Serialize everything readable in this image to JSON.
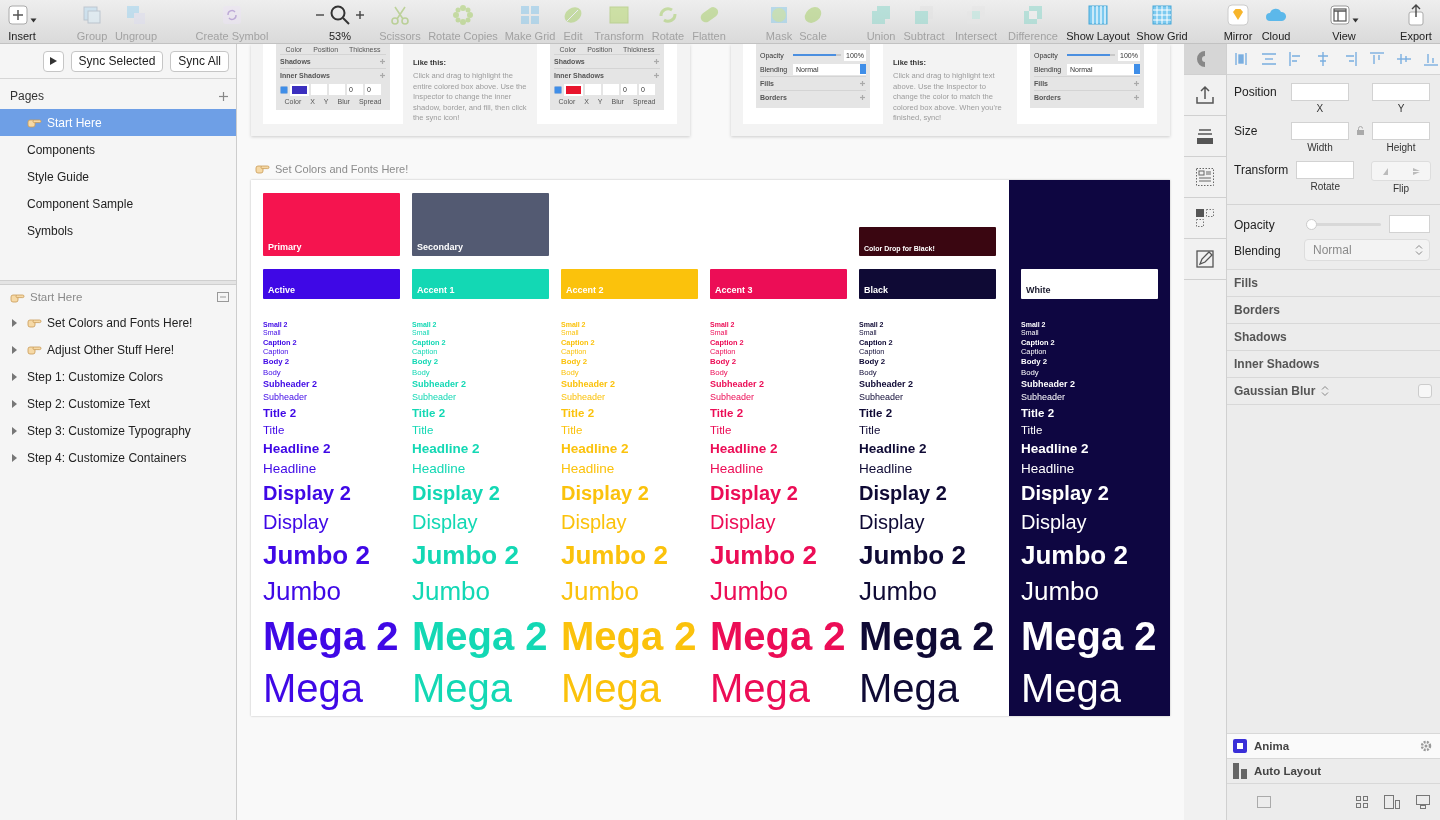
{
  "toolbar": {
    "items": [
      {
        "label": "Insert",
        "kind": "menu",
        "disabled": false
      },
      {
        "label": "Group",
        "kind": "button",
        "disabled": true
      },
      {
        "label": "Ungroup",
        "kind": "button",
        "disabled": true
      },
      {
        "label": "Create Symbol",
        "kind": "button",
        "disabled": true
      },
      {
        "label": "53%",
        "kind": "zoom",
        "disabled": false
      },
      {
        "label": "Scissors",
        "kind": "button",
        "disabled": true
      },
      {
        "label": "Rotate Copies",
        "kind": "button",
        "disabled": true
      },
      {
        "label": "Make Grid",
        "kind": "button",
        "disabled": true
      },
      {
        "label": "Edit",
        "kind": "button",
        "disabled": true
      },
      {
        "label": "Transform",
        "kind": "button",
        "disabled": true
      },
      {
        "label": "Rotate",
        "kind": "button",
        "disabled": true
      },
      {
        "label": "Flatten",
        "kind": "button",
        "disabled": true
      },
      {
        "label": "Mask",
        "kind": "button",
        "disabled": true
      },
      {
        "label": "Scale",
        "kind": "button",
        "disabled": true
      },
      {
        "label": "Union",
        "kind": "button",
        "disabled": true
      },
      {
        "label": "Subtract",
        "kind": "button",
        "disabled": true
      },
      {
        "label": "Intersect",
        "kind": "button",
        "disabled": true
      },
      {
        "label": "Difference",
        "kind": "button",
        "disabled": true
      },
      {
        "label": "Show Layout",
        "kind": "button",
        "disabled": false
      },
      {
        "label": "Show Grid",
        "kind": "button",
        "disabled": false
      },
      {
        "label": "Mirror",
        "kind": "button",
        "disabled": false
      },
      {
        "label": "Cloud",
        "kind": "button",
        "disabled": false
      },
      {
        "label": "View",
        "kind": "menu",
        "disabled": false
      },
      {
        "label": "Export",
        "kind": "button",
        "disabled": false
      }
    ]
  },
  "sync_bar": {
    "buttons": [
      "Sync Selected",
      "Sync All"
    ]
  },
  "pages": {
    "title": "Pages",
    "items": [
      {
        "label": "Start Here",
        "emoji": true,
        "selected": true
      },
      {
        "label": "Components",
        "emoji": false,
        "selected": false
      },
      {
        "label": "Style Guide",
        "emoji": false,
        "selected": false
      },
      {
        "label": "Component Sample",
        "emoji": false,
        "selected": false
      },
      {
        "label": "Symbols",
        "emoji": false,
        "selected": false
      }
    ]
  },
  "layers": {
    "artboard": {
      "label": "Start Here",
      "emoji": true
    },
    "items": [
      {
        "label": "Set Colors and Fonts Here!",
        "emoji": true,
        "expanded": false
      },
      {
        "label": "Adjust Other Stuff Here!",
        "emoji": true,
        "expanded": false
      },
      {
        "label": "Step 1: Customize Colors",
        "emoji": false,
        "expanded": false
      },
      {
        "label": "Step 2: Customize Text",
        "emoji": false,
        "expanded": false
      },
      {
        "label": "Step 3: Customize Typography",
        "emoji": false,
        "expanded": false
      },
      {
        "label": "Step 4: Customize Containers",
        "emoji": false,
        "expanded": false
      }
    ]
  },
  "tutorial_cards": [
    {
      "panels": [
        {
          "kind": "shadow",
          "captions": [
            "Color",
            "Position",
            "Thickness"
          ],
          "sections": [
            "Shadows",
            "Inner Shadows"
          ],
          "checked": true,
          "color": "#3b2fbf",
          "values": [
            "0",
            "0"
          ],
          "field_captions": [
            "Color",
            "X",
            "Y",
            "Blur",
            "Spread"
          ]
        },
        {
          "kind": "shadow",
          "captions": [
            "Color",
            "Position",
            "Thickness"
          ],
          "sections": [
            "Shadows",
            "Inner Shadows"
          ],
          "checked": true,
          "color": "#e8142c",
          "values": [
            "0",
            "0"
          ],
          "field_captions": [
            "Color",
            "X",
            "Y",
            "Blur",
            "Spread"
          ]
        }
      ],
      "note": {
        "heading": "Like this:",
        "text": "Click and drag to highlight the entire colored box above. Use the Inspector to change the inner shadow, border, and fill, then click the sync icon!"
      }
    },
    {
      "panels": [
        {
          "kind": "layer",
          "opacity_label": "Opacity",
          "level": 0.9,
          "opacity_value": "100%",
          "blending_label": "Blending",
          "blending_value": "Normal",
          "sections": [
            "Fills",
            "Borders"
          ]
        },
        {
          "kind": "layer",
          "opacity_label": "Opacity",
          "level": 0.9,
          "opacity_value": "100%",
          "blending_label": "Blending",
          "blending_value": "Normal",
          "sections": [
            "Fills",
            "Borders"
          ]
        }
      ],
      "note": {
        "heading": "Like this:",
        "text": "Click and drag to highlight text above. Use the Inspector to change the color to match the colored box above. When you're finished, sync!"
      }
    }
  ],
  "section_label": {
    "text": "Set Colors and Fonts Here!",
    "emoji": true
  },
  "palette": {
    "columns": [
      {
        "dark": false,
        "top_swatch": {
          "label": "Primary",
          "color": "#f5144f",
          "kind": "tall"
        },
        "swatch": {
          "label": "Active",
          "color": "#3f08e6"
        },
        "styles": [
          {
            "label": "Small 2",
            "kind": "small",
            "bold": true
          },
          {
            "label": "Small",
            "kind": "small",
            "bold": false
          },
          {
            "label": "Caption 2",
            "kind": "caption",
            "bold": true
          },
          {
            "label": "Caption",
            "kind": "caption",
            "bold": false
          },
          {
            "label": "Body 2",
            "kind": "body",
            "bold": true
          },
          {
            "label": "Body",
            "kind": "body",
            "bold": false
          },
          {
            "label": "Subheader 2",
            "kind": "subheader",
            "bold": true
          },
          {
            "label": "Subheader",
            "kind": "subheader",
            "bold": false
          },
          {
            "label": "Title 2",
            "kind": "title",
            "bold": true
          },
          {
            "label": "Title",
            "kind": "title",
            "bold": false
          },
          {
            "label": "Headline 2",
            "kind": "headline",
            "bold": true
          },
          {
            "label": "Headline",
            "kind": "headline",
            "bold": false
          },
          {
            "label": "Display 2",
            "kind": "display",
            "bold": true
          },
          {
            "label": "Display",
            "kind": "display",
            "bold": false
          },
          {
            "label": "Jumbo 2",
            "kind": "jumbo",
            "bold": true
          },
          {
            "label": "Jumbo",
            "kind": "jumbo",
            "bold": false
          },
          {
            "label": "Mega 2",
            "kind": "mega",
            "bold": true
          },
          {
            "label": "Mega",
            "kind": "mega",
            "bold": false
          }
        ]
      },
      {
        "dark": false,
        "top_swatch": {
          "label": "Secondary",
          "color": "#535a72",
          "kind": "tall"
        },
        "swatch": {
          "label": "Accent 1",
          "color": "#13d8b4"
        },
        "styles": [
          {
            "label": "Small 2",
            "kind": "small",
            "bold": true
          },
          {
            "label": "Small",
            "kind": "small",
            "bold": false
          },
          {
            "label": "Caption 2",
            "kind": "caption",
            "bold": true
          },
          {
            "label": "Caption",
            "kind": "caption",
            "bold": false
          },
          {
            "label": "Body 2",
            "kind": "body",
            "bold": true
          },
          {
            "label": "Body",
            "kind": "body",
            "bold": false
          },
          {
            "label": "Subheader 2",
            "kind": "subheader",
            "bold": true
          },
          {
            "label": "Subheader",
            "kind": "subheader",
            "bold": false
          },
          {
            "label": "Title 2",
            "kind": "title",
            "bold": true
          },
          {
            "label": "Title",
            "kind": "title",
            "bold": false
          },
          {
            "label": "Headline 2",
            "kind": "headline",
            "bold": true
          },
          {
            "label": "Headline",
            "kind": "headline",
            "bold": false
          },
          {
            "label": "Display 2",
            "kind": "display",
            "bold": true
          },
          {
            "label": "Display",
            "kind": "display",
            "bold": false
          },
          {
            "label": "Jumbo 2",
            "kind": "jumbo",
            "bold": true
          },
          {
            "label": "Jumbo",
            "kind": "jumbo",
            "bold": false
          },
          {
            "label": "Mega 2",
            "kind": "mega",
            "bold": true
          },
          {
            "label": "Mega",
            "kind": "mega",
            "bold": false
          }
        ]
      },
      {
        "dark": false,
        "swatch": {
          "label": "Accent 2",
          "color": "#fbc20c"
        },
        "styles": [
          {
            "label": "Small 2",
            "kind": "small",
            "bold": true
          },
          {
            "label": "Small",
            "kind": "small",
            "bold": false
          },
          {
            "label": "Caption 2",
            "kind": "caption",
            "bold": true
          },
          {
            "label": "Caption",
            "kind": "caption",
            "bold": false
          },
          {
            "label": "Body 2",
            "kind": "body",
            "bold": true
          },
          {
            "label": "Body",
            "kind": "body",
            "bold": false
          },
          {
            "label": "Subheader 2",
            "kind": "subheader",
            "bold": true
          },
          {
            "label": "Subheader",
            "kind": "subheader",
            "bold": false
          },
          {
            "label": "Title 2",
            "kind": "title",
            "bold": true
          },
          {
            "label": "Title",
            "kind": "title",
            "bold": false
          },
          {
            "label": "Headline 2",
            "kind": "headline",
            "bold": true
          },
          {
            "label": "Headline",
            "kind": "headline",
            "bold": false
          },
          {
            "label": "Display 2",
            "kind": "display",
            "bold": true
          },
          {
            "label": "Display",
            "kind": "display",
            "bold": false
          },
          {
            "label": "Jumbo 2",
            "kind": "jumbo",
            "bold": true
          },
          {
            "label": "Jumbo",
            "kind": "jumbo",
            "bold": false
          },
          {
            "label": "Mega 2",
            "kind": "mega",
            "bold": true
          },
          {
            "label": "Mega",
            "kind": "mega",
            "bold": false
          }
        ]
      },
      {
        "dark": false,
        "swatch": {
          "label": "Accent 3",
          "color": "#ec0d56"
        },
        "styles": [
          {
            "label": "Small 2",
            "kind": "small",
            "bold": true
          },
          {
            "label": "Small",
            "kind": "small",
            "bold": false
          },
          {
            "label": "Caption 2",
            "kind": "caption",
            "bold": true
          },
          {
            "label": "Caption",
            "kind": "caption",
            "bold": false
          },
          {
            "label": "Body 2",
            "kind": "body",
            "bold": true
          },
          {
            "label": "Body",
            "kind": "body",
            "bold": false
          },
          {
            "label": "Subheader 2",
            "kind": "subheader",
            "bold": true
          },
          {
            "label": "Subheader",
            "kind": "subheader",
            "bold": false
          },
          {
            "label": "Title 2",
            "kind": "title",
            "bold": true
          },
          {
            "label": "Title",
            "kind": "title",
            "bold": false
          },
          {
            "label": "Headline 2",
            "kind": "headline",
            "bold": true
          },
          {
            "label": "Headline",
            "kind": "headline",
            "bold": false
          },
          {
            "label": "Display 2",
            "kind": "display",
            "bold": true
          },
          {
            "label": "Display",
            "kind": "display",
            "bold": false
          },
          {
            "label": "Jumbo 2",
            "kind": "jumbo",
            "bold": true
          },
          {
            "label": "Jumbo",
            "kind": "jumbo",
            "bold": false
          },
          {
            "label": "Mega 2",
            "kind": "mega",
            "bold": true
          },
          {
            "label": "Mega",
            "kind": "mega",
            "bold": false
          }
        ]
      },
      {
        "dark": false,
        "top_swatch": {
          "label": "Color Drop for Black!",
          "color": "#3a0611",
          "kind": "short"
        },
        "swatch": {
          "label": "Black",
          "color": "#0f0a35"
        },
        "styles": [
          {
            "label": "Small 2",
            "kind": "small",
            "bold": true
          },
          {
            "label": "Small",
            "kind": "small",
            "bold": false
          },
          {
            "label": "Caption 2",
            "kind": "caption",
            "bold": true
          },
          {
            "label": "Caption",
            "kind": "caption",
            "bold": false
          },
          {
            "label": "Body 2",
            "kind": "body",
            "bold": true
          },
          {
            "label": "Body",
            "kind": "body",
            "bold": false
          },
          {
            "label": "Subheader 2",
            "kind": "subheader",
            "bold": true
          },
          {
            "label": "Subheader",
            "kind": "subheader",
            "bold": false
          },
          {
            "label": "Title 2",
            "kind": "title",
            "bold": true
          },
          {
            "label": "Title",
            "kind": "title",
            "bold": false
          },
          {
            "label": "Headline 2",
            "kind": "headline",
            "bold": true
          },
          {
            "label": "Headline",
            "kind": "headline",
            "bold": false
          },
          {
            "label": "Display 2",
            "kind": "display",
            "bold": true
          },
          {
            "label": "Display",
            "kind": "display",
            "bold": false
          },
          {
            "label": "Jumbo 2",
            "kind": "jumbo",
            "bold": true
          },
          {
            "label": "Jumbo",
            "kind": "jumbo",
            "bold": false
          },
          {
            "label": "Mega 2",
            "kind": "mega",
            "bold": true
          },
          {
            "label": "Mega",
            "kind": "mega",
            "bold": false
          }
        ]
      },
      {
        "dark": true,
        "swatch": {
          "label": "White",
          "color": "#ffffff"
        },
        "styles": [
          {
            "label": "Small 2",
            "kind": "small",
            "bold": true
          },
          {
            "label": "Small",
            "kind": "small",
            "bold": false
          },
          {
            "label": "Caption 2",
            "kind": "caption",
            "bold": true
          },
          {
            "label": "Caption",
            "kind": "caption",
            "bold": false
          },
          {
            "label": "Body 2",
            "kind": "body",
            "bold": true
          },
          {
            "label": "Body",
            "kind": "body",
            "bold": false
          },
          {
            "label": "Subheader 2",
            "kind": "subheader",
            "bold": true
          },
          {
            "label": "Subheader",
            "kind": "subheader",
            "bold": false
          },
          {
            "label": "Title 2",
            "kind": "title",
            "bold": true
          },
          {
            "label": "Title",
            "kind": "title",
            "bold": false
          },
          {
            "label": "Headline 2",
            "kind": "headline",
            "bold": true
          },
          {
            "label": "Headline",
            "kind": "headline",
            "bold": false
          },
          {
            "label": "Display 2",
            "kind": "display",
            "bold": true
          },
          {
            "label": "Display",
            "kind": "display",
            "bold": false
          },
          {
            "label": "Jumbo 2",
            "kind": "jumbo",
            "bold": true
          },
          {
            "label": "Jumbo",
            "kind": "jumbo",
            "bold": false
          },
          {
            "label": "Mega 2",
            "kind": "mega",
            "bold": true
          },
          {
            "label": "Mega",
            "kind": "mega",
            "bold": false
          }
        ]
      }
    ]
  },
  "inspector": {
    "geometry": [
      {
        "label": "Position",
        "kind": "pair",
        "captions": [
          "X",
          "Y"
        ]
      },
      {
        "label": "Size",
        "kind": "locked",
        "captions": [
          "Width",
          "Height"
        ]
      },
      {
        "label": "Transform",
        "kind": "flip",
        "captions": [
          "Rotate",
          "Flip"
        ]
      }
    ],
    "opacity": {
      "label": "Opacity",
      "level": 0
    },
    "blending": {
      "label": "Blending",
      "value": "Normal"
    },
    "sections": [
      {
        "label": "Fills",
        "kind": "plain"
      },
      {
        "label": "Borders",
        "kind": "plain"
      },
      {
        "label": "Shadows",
        "kind": "plain"
      },
      {
        "label": "Inner Shadows",
        "kind": "plain"
      },
      {
        "label": "Gaussian Blur",
        "kind": "toggle",
        "checked": false
      }
    ],
    "plugins": [
      {
        "label": "Anima",
        "kind": "settings"
      },
      {
        "label": "Auto Layout",
        "kind": "plain"
      }
    ]
  }
}
